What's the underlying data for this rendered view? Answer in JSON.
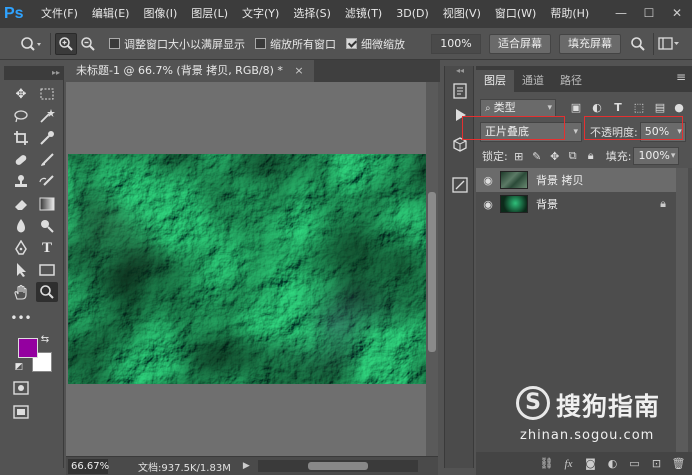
{
  "app": {
    "logo": "Ps"
  },
  "menu": [
    "文件(F)",
    "编辑(E)",
    "图像(I)",
    "图层(L)",
    "文字(Y)",
    "选择(S)",
    "滤镜(T)",
    "3D(D)",
    "视图(V)",
    "窗口(W)",
    "帮助(H)"
  ],
  "window_controls": {
    "minimize": "—",
    "maximize": "☐",
    "close": "✕"
  },
  "options_bar": {
    "tool_icon": "zoom-icon",
    "resize_windows_label": "调整窗口大小以满屏显示",
    "resize_windows_checked": false,
    "zoom_all_label": "缩放所有窗口",
    "zoom_all_checked": false,
    "scrubby_zoom_label": "细微缩放",
    "scrubby_zoom_checked": true,
    "zoom_percent": "100%",
    "fit_screen_label": "适合屏幕",
    "fill_screen_label": "填充屏幕"
  },
  "document": {
    "tab_title": "未标题-1 @ 66.7% (背景 拷贝, RGB/8) *",
    "close": "×"
  },
  "status": {
    "zoom": "66.67%",
    "doc_info": "文档:937.5K/1.83M",
    "arrow": "▶"
  },
  "colors": {
    "foreground": "#9400a0",
    "background": "#ffffff",
    "highlight": "#e53030"
  },
  "layers_panel": {
    "tabs": [
      "图层",
      "通道",
      "路径"
    ],
    "filter_kind": "类型",
    "blend_mode": "正片叠底",
    "opacity_label": "不透明度:",
    "opacity_value": "50%",
    "lock_label": "锁定:",
    "fill_label": "填充:",
    "fill_value": "100%",
    "layers": [
      {
        "name": "背景 拷贝",
        "visible": true,
        "selected": true,
        "locked": false
      },
      {
        "name": "背景",
        "visible": true,
        "selected": false,
        "locked": true
      }
    ]
  },
  "watermark": {
    "logo_letter": "S",
    "brand": "搜狗指南",
    "url": "zhinan.sogou.com"
  }
}
